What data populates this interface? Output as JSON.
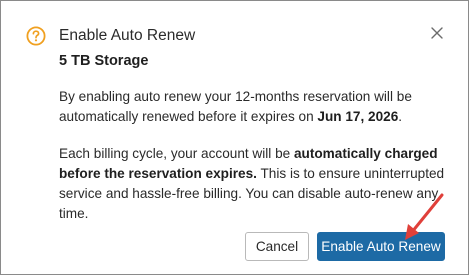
{
  "dialog": {
    "title": "Enable Auto Renew",
    "subtitle": "5 TB Storage",
    "icons": {
      "help": "question-circle-icon",
      "close": "close-x-icon"
    },
    "colors": {
      "help_icon": "#f0a020",
      "primary": "#1d6aa5",
      "annotation_arrow": "#e0403a"
    },
    "paragraph1": {
      "text": "By enabling auto renew your 12-months reservation will be automatically renewed before it expires on ",
      "date": "Jun 17, 2026",
      "end": "."
    },
    "paragraph2": {
      "text": "Each billing cycle, your account will be ",
      "bold": "automatically charged before the reservation expires.",
      "rest": " This is to ensure uninterrupted service and hassle-free billing. You can disable auto-renew any time."
    },
    "buttons": {
      "cancel": "Cancel",
      "confirm": "Enable Auto Renew"
    }
  }
}
